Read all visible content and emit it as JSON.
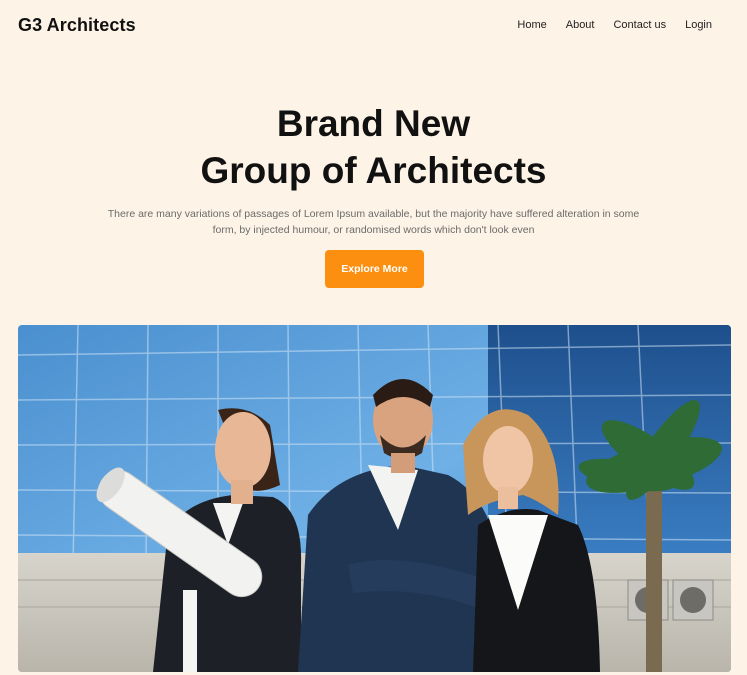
{
  "brand": {
    "name": "G3 Architects"
  },
  "nav": {
    "items": [
      {
        "label": "Home"
      },
      {
        "label": "About"
      },
      {
        "label": "Contact us"
      },
      {
        "label": "Login"
      }
    ]
  },
  "hero": {
    "title_line1": "Brand New",
    "title_line2": "Group of Architects",
    "description": "There are many variations of passages of Lorem Ipsum available, but the majority have suffered alteration in some form, by injected humour, or randomised words which don't look even",
    "cta_label": "Explore More"
  },
  "image": {
    "semantic": "team-of-three-architects-photo"
  },
  "colors": {
    "background": "#fdf3e6",
    "accent": "#fd8f10",
    "text": "#121212",
    "muted": "#6b6b6b"
  }
}
